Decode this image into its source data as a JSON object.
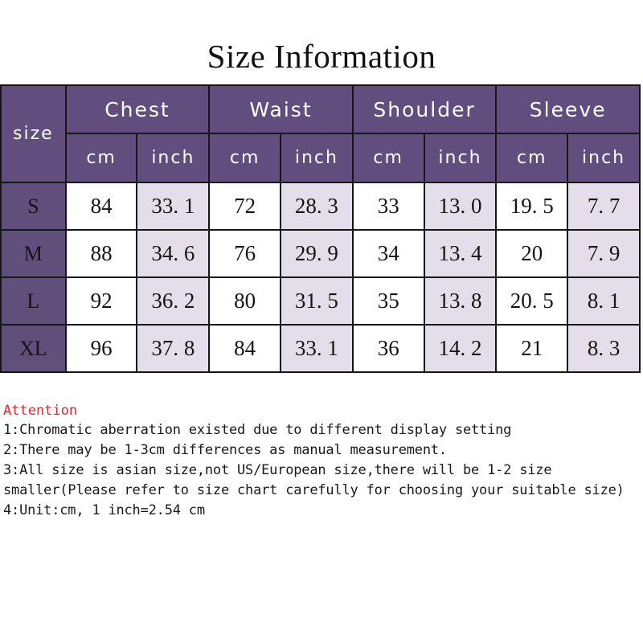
{
  "title": "Size Information",
  "table": {
    "size_header": "size",
    "groups": [
      "Chest",
      "Waist",
      "Shoulder",
      "Sleeve"
    ],
    "units": [
      "cm",
      "inch"
    ],
    "unit_row": [
      "cm",
      "inch",
      "cm",
      "inch",
      "cm",
      "inch",
      "cm",
      "inch"
    ],
    "rows": [
      {
        "size": "S",
        "values": [
          "84",
          "33. 1",
          "72",
          "28. 3",
          "33",
          "13. 0",
          "19. 5",
          "7. 7"
        ]
      },
      {
        "size": "M",
        "values": [
          "88",
          "34. 6",
          "76",
          "29. 9",
          "34",
          "13. 4",
          "20",
          "7. 9"
        ]
      },
      {
        "size": "L",
        "values": [
          "92",
          "36. 2",
          "80",
          "31. 5",
          "35",
          "13. 8",
          "20. 5",
          "8. 1"
        ]
      },
      {
        "size": "XL",
        "values": [
          "96",
          "37. 8",
          "84",
          "33. 1",
          "36",
          "14. 2",
          "21",
          "8. 3"
        ]
      }
    ]
  },
  "notes": {
    "heading": "Attention",
    "lines": [
      "1:Chromatic aberration existed due to different display setting",
      "2:There may be 1-3cm differences as manual measurement.",
      "3:All size is asian size,not US/European size,there will be 1-2 size smaller(Please refer to size chart carefully for choosing your suitable size)",
      "4:Unit:cm, 1 inch=2.54 cm"
    ]
  },
  "colors": {
    "header_purple": "#614d7e",
    "size_cell_purple": "#604e7b",
    "inch_cell_bg": "#e3dee9",
    "cm_cell_bg": "#ffffff",
    "grid_line": "#161616",
    "attention_red": "#e8252a",
    "page_bg": "#ffffff"
  }
}
